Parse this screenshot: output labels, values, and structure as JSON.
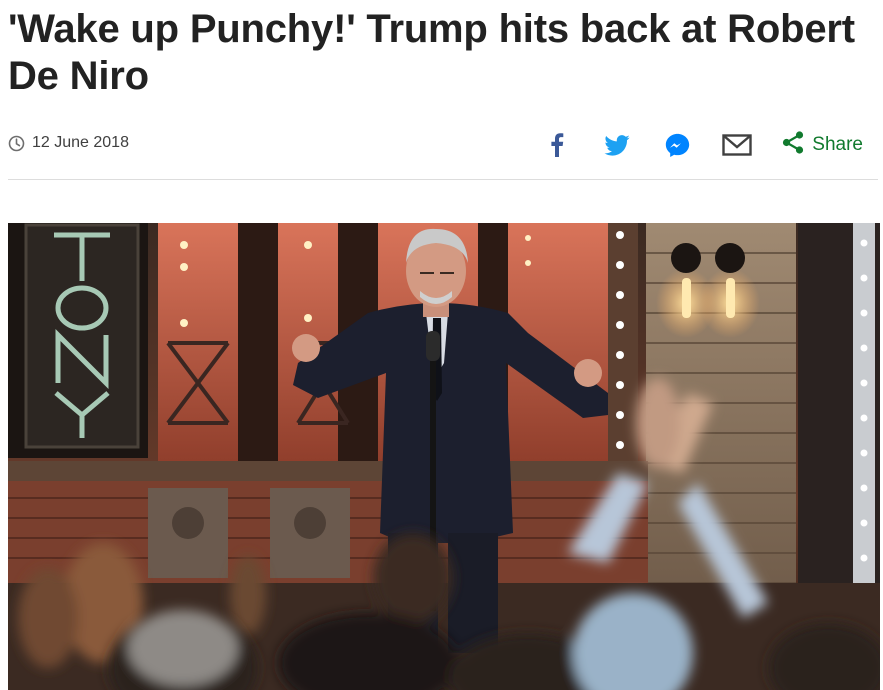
{
  "article": {
    "headline": "'Wake up Punchy!' Trump hits back at Robert De Niro",
    "date": "12 June 2018"
  },
  "share": {
    "items": [
      {
        "name": "facebook",
        "icon": "facebook-icon",
        "color": "#3b5998"
      },
      {
        "name": "twitter",
        "icon": "twitter-icon",
        "color": "#1da1f2"
      },
      {
        "name": "messenger",
        "icon": "messenger-icon",
        "color": "#0084ff"
      },
      {
        "name": "email",
        "icon": "email-icon",
        "color": "#404040"
      }
    ],
    "more_label": "Share",
    "more_color": "#117a2e"
  },
  "photo": {
    "sign_text": "TONY",
    "icon": "stage-photo"
  }
}
